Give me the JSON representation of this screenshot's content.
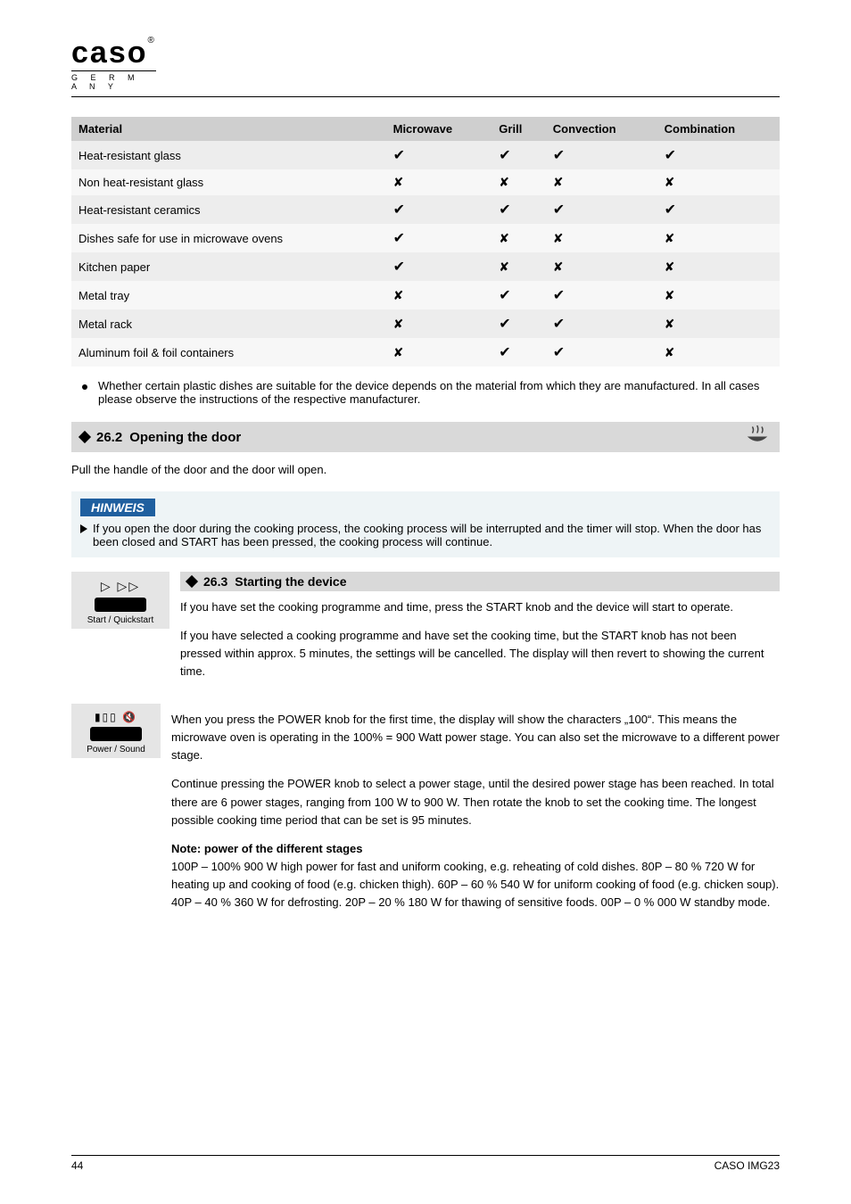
{
  "logo": {
    "brand": "caso",
    "sub": "G E R M A N Y",
    "reg": "®"
  },
  "table": {
    "headers": [
      "Material",
      "Microwave",
      "Grill",
      "Convection",
      "Combination"
    ],
    "rows": [
      {
        "label": "Heat-resistant glass",
        "cells": [
          "✔",
          "✔",
          "✔",
          "✔"
        ]
      },
      {
        "label": "Non heat-resistant glass",
        "cells": [
          "✘",
          "✘",
          "✘",
          "✘"
        ]
      },
      {
        "label": "Heat-resistant ceramics",
        "cells": [
          "✔",
          "✔",
          "✔",
          "✔"
        ]
      },
      {
        "label": "Dishes safe for use in microwave ovens",
        "cells": [
          "✔",
          "✘",
          "✘",
          "✘"
        ]
      },
      {
        "label": "Kitchen paper",
        "cells": [
          "✔",
          "✘",
          "✘",
          "✘"
        ]
      },
      {
        "label": "Metal tray",
        "cells": [
          "✘",
          "✔",
          "✔",
          "✘"
        ]
      },
      {
        "label": "Metal rack",
        "cells": [
          "✘",
          "✔",
          "✔",
          "✘"
        ]
      },
      {
        "label": "Aluminum foil & foil containers",
        "cells": [
          "✘",
          "✔",
          "✔",
          "✘"
        ]
      }
    ]
  },
  "bullet": "Whether certain plastic dishes are suitable for the device depends on the material from which they are manufactured. In all cases please observe the instructions of the respective manufacturer.",
  "sect_open": {
    "num": "26.2",
    "title": "Opening the door",
    "body": "Pull the handle of the door and the door will open."
  },
  "note": {
    "badge": "HINWEIS",
    "text": "If you open the door during the cooking process, the cooking process will be interrupted and the timer will stop. When the door has been closed and START has been pressed, the cooking process will continue."
  },
  "sect_start": {
    "num": "26.3",
    "title": "Starting the device",
    "illust_label": "Start / Quickstart",
    "p1": "If you have set the cooking programme and time, press the START knob and the device will start to operate.",
    "p2": "If you have selected a cooking programme and have set the cooking time, but the START knob has not been pressed within approx. 5 minutes, the settings will be cancelled. The display will then revert to showing the current time."
  },
  "sect_power": {
    "illust_label": "Power / Sound",
    "p1": "When you press the POWER knob for the first time, the display will show the characters „100“. This means the microwave oven is operating in the 100% = 900 Watt power stage. You can also set the microwave to a different power stage.",
    "p2": "Continue pressing the POWER knob to select a power stage, until the desired power stage has been reached. In total there are 6 power stages, ranging from 100 W to 900 W. Then rotate the knob to set the cooking time. The longest possible cooking time period that can be set is 95 minutes.",
    "note_title": "Note: power of the different stages",
    "note_body": "100P – 100% 900 W high power for fast and uniform cooking, e.g. reheating of cold dishes. 80P – 80 % 720 W for heating up and cooking of food (e.g. chicken thigh). 60P – 60 % 540 W for uniform cooking of food (e.g. chicken soup). 40P – 40 % 360 W for defrosting. 20P – 20 % 180 W for thawing of sensitive foods. 00P – 0 % 000 W standby mode."
  },
  "footer": {
    "left": "44",
    "right": "CASO IMG23"
  }
}
